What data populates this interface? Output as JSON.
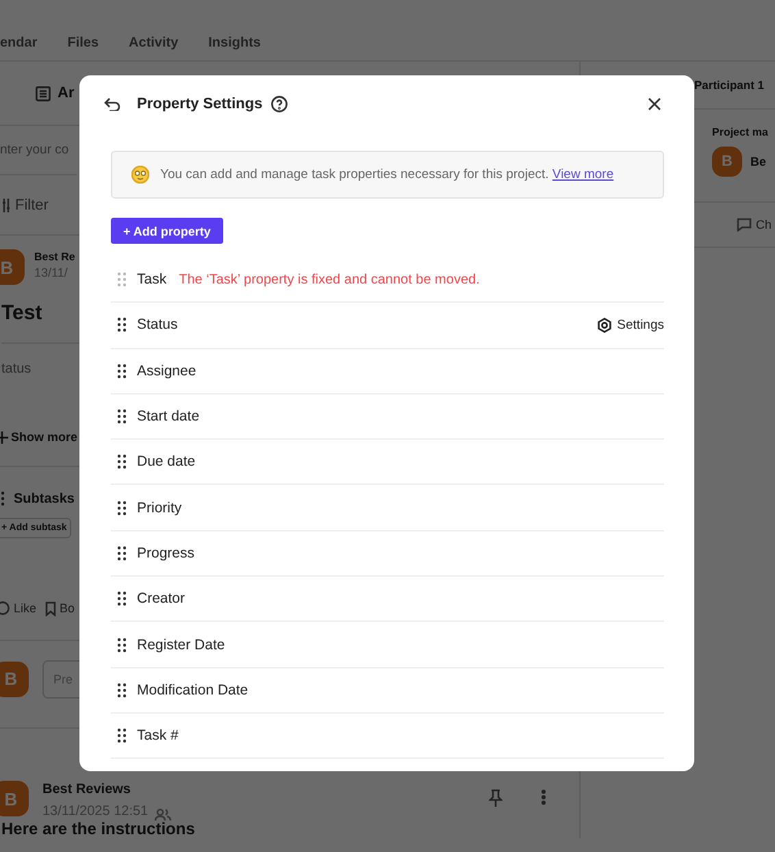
{
  "background": {
    "tabs": [
      "endar",
      "Files",
      "Activity",
      "Insights"
    ],
    "left": {
      "view_tab": "Ar",
      "editor_placeholder": "nter your co",
      "filter": "Filter",
      "post": {
        "avatar": "B",
        "author": "Best Re",
        "date": "13/11/"
      },
      "title": "Test",
      "field_label": "tatus",
      "show_more": "Show more",
      "subtasks": "Subtasks",
      "add_subtask": "+ Add subtask",
      "actions": [
        "Like",
        "Bo"
      ],
      "comment": {
        "avatar": "B",
        "placeholder": "Pre"
      },
      "reply": {
        "avatar": "B",
        "author": "Best Reviews",
        "date": "13/11/2025 12:51"
      },
      "body": "Here are the instructions"
    },
    "right": {
      "title": "Participant 1",
      "section": "Project ma",
      "member": {
        "avatar": "B",
        "name": "Be"
      },
      "chat": "Ch"
    }
  },
  "dialog": {
    "title": "Property Settings",
    "info": {
      "text": "You can add and manage task properties necessary for this project.",
      "link": "View more"
    },
    "add_button": "+ Add property",
    "properties": [
      {
        "label": "Task",
        "fixed": true,
        "note": "The ‘Task’ property is fixed and cannot be moved."
      },
      {
        "label": "Status",
        "fixed": false,
        "action": "Settings"
      },
      {
        "label": "Assignee",
        "fixed": false
      },
      {
        "label": "Start date",
        "fixed": false
      },
      {
        "label": "Due date",
        "fixed": false
      },
      {
        "label": "Priority",
        "fixed": false
      },
      {
        "label": "Progress",
        "fixed": false
      },
      {
        "label": "Creator",
        "fixed": false
      },
      {
        "label": "Register Date",
        "fixed": false
      },
      {
        "label": "Modification Date",
        "fixed": false
      },
      {
        "label": "Task #",
        "fixed": false
      }
    ]
  }
}
